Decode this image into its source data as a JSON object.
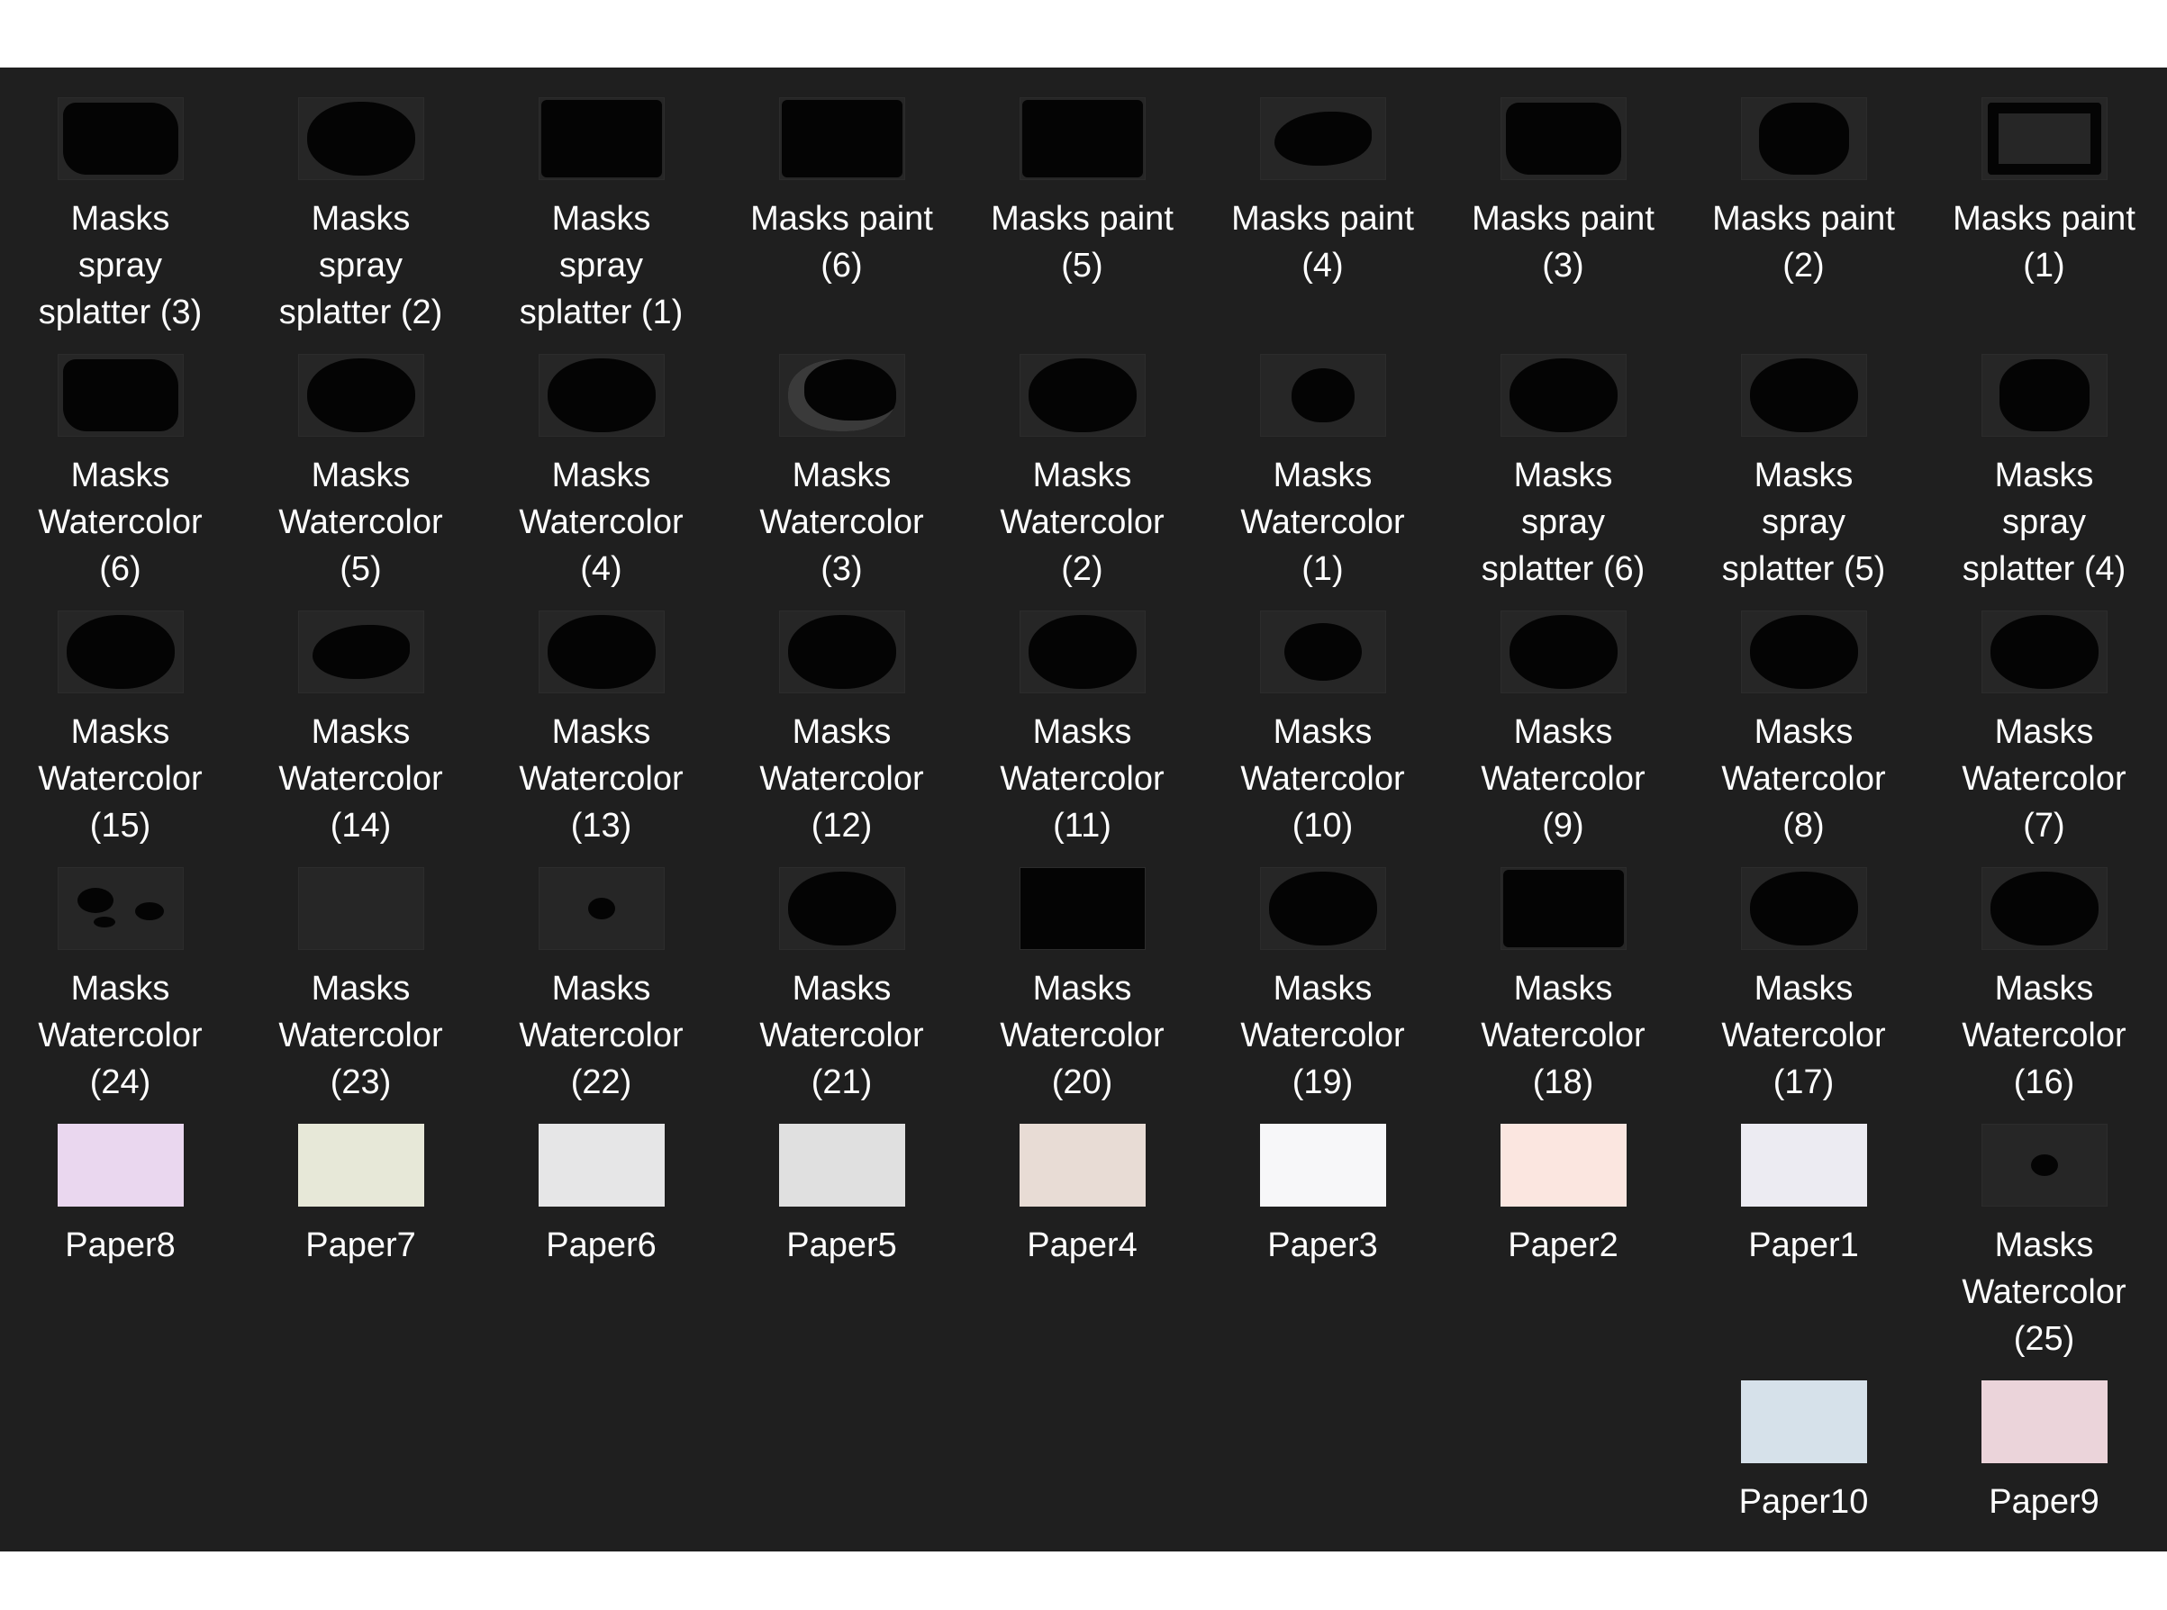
{
  "files": [
    {
      "name": "Masks spray splatter (3)",
      "label": "Masks\nspray\nsplatter (3)",
      "kind": "mask",
      "shape": "brush",
      "col": 0,
      "row": 0
    },
    {
      "name": "Masks spray splatter (2)",
      "label": "Masks\nspray\nsplatter (2)",
      "kind": "mask",
      "shape": "blob",
      "col": 1,
      "row": 0
    },
    {
      "name": "Masks spray splatter (1)",
      "label": "Masks\nspray\nsplatter (1)",
      "kind": "mask",
      "shape": "rect",
      "col": 2,
      "row": 0
    },
    {
      "name": "Masks paint (6)",
      "label": "Masks paint\n(6)",
      "kind": "mask",
      "shape": "rect",
      "col": 3,
      "row": 0
    },
    {
      "name": "Masks paint (5)",
      "label": "Masks paint\n(5)",
      "kind": "mask",
      "shape": "rect",
      "col": 4,
      "row": 0
    },
    {
      "name": "Masks paint (4)",
      "label": "Masks paint\n(4)",
      "kind": "mask",
      "shape": "stroke",
      "col": 5,
      "row": 0
    },
    {
      "name": "Masks paint (3)",
      "label": "Masks paint\n(3)",
      "kind": "mask",
      "shape": "brush",
      "col": 6,
      "row": 0
    },
    {
      "name": "Masks paint (2)",
      "label": "Masks paint\n(2)",
      "kind": "mask",
      "shape": "splat",
      "col": 7,
      "row": 0
    },
    {
      "name": "Masks paint (1)",
      "label": "Masks paint\n(1)",
      "kind": "mask",
      "shape": "frame",
      "col": 8,
      "row": 0
    },
    {
      "name": "Masks Watercolor (6)",
      "label": "Masks\nWatercolor\n(6)",
      "kind": "mask",
      "shape": "brush",
      "col": 0,
      "row": 1
    },
    {
      "name": "Masks Watercolor (5)",
      "label": "Masks\nWatercolor\n(5)",
      "kind": "mask",
      "shape": "blob",
      "col": 1,
      "row": 1
    },
    {
      "name": "Masks Watercolor (4)",
      "label": "Masks\nWatercolor\n(4)",
      "kind": "mask",
      "shape": "blob",
      "col": 2,
      "row": 1
    },
    {
      "name": "Masks Watercolor (3)",
      "label": "Masks\nWatercolor\n(3)",
      "kind": "mask",
      "shape": "ring",
      "col": 3,
      "row": 1
    },
    {
      "name": "Masks Watercolor (2)",
      "label": "Masks\nWatercolor\n(2)",
      "kind": "mask",
      "shape": "blob",
      "col": 4,
      "row": 1
    },
    {
      "name": "Masks Watercolor (1)",
      "label": "Masks\nWatercolor\n(1)",
      "kind": "mask",
      "shape": "heart",
      "col": 5,
      "row": 1
    },
    {
      "name": "Masks spray splatter (6)",
      "label": "Masks\nspray\nsplatter (6)",
      "kind": "mask",
      "shape": "blob",
      "col": 6,
      "row": 1
    },
    {
      "name": "Masks spray splatter (5)",
      "label": "Masks\nspray\nsplatter (5)",
      "kind": "mask",
      "shape": "blob",
      "col": 7,
      "row": 1
    },
    {
      "name": "Masks spray splatter (4)",
      "label": "Masks\nspray\nsplatter (4)",
      "kind": "mask",
      "shape": "splat",
      "col": 8,
      "row": 1
    },
    {
      "name": "Masks Watercolor (15)",
      "label": "Masks\nWatercolor\n(15)",
      "kind": "mask",
      "shape": "blob",
      "col": 0,
      "row": 2
    },
    {
      "name": "Masks Watercolor (14)",
      "label": "Masks\nWatercolor\n(14)",
      "kind": "mask",
      "shape": "stroke",
      "col": 1,
      "row": 2
    },
    {
      "name": "Masks Watercolor (13)",
      "label": "Masks\nWatercolor\n(13)",
      "kind": "mask",
      "shape": "blob",
      "col": 2,
      "row": 2
    },
    {
      "name": "Masks Watercolor (12)",
      "label": "Masks\nWatercolor\n(12)",
      "kind": "mask",
      "shape": "blob",
      "col": 3,
      "row": 2
    },
    {
      "name": "Masks Watercolor (11)",
      "label": "Masks\nWatercolor\n(11)",
      "kind": "mask",
      "shape": "blob",
      "col": 4,
      "row": 2
    },
    {
      "name": "Masks Watercolor (10)",
      "label": "Masks\nWatercolor\n(10)",
      "kind": "mask",
      "shape": "small",
      "col": 5,
      "row": 2
    },
    {
      "name": "Masks Watercolor (9)",
      "label": "Masks\nWatercolor\n(9)",
      "kind": "mask",
      "shape": "blob",
      "col": 6,
      "row": 2
    },
    {
      "name": "Masks Watercolor (8)",
      "label": "Masks\nWatercolor\n(8)",
      "kind": "mask",
      "shape": "blob",
      "col": 7,
      "row": 2
    },
    {
      "name": "Masks Watercolor (7)",
      "label": "Masks\nWatercolor\n(7)",
      "kind": "mask",
      "shape": "blob",
      "col": 8,
      "row": 2
    },
    {
      "name": "Masks Watercolor (24)",
      "label": "Masks\nWatercolor\n(24)",
      "kind": "mask",
      "shape": "drips",
      "col": 0,
      "row": 3
    },
    {
      "name": "Masks Watercolor (23)",
      "label": "Masks\nWatercolor\n(23)",
      "kind": "mask",
      "shape": "none",
      "col": 1,
      "row": 3
    },
    {
      "name": "Masks Watercolor (22)",
      "label": "Masks\nWatercolor\n(22)",
      "kind": "mask",
      "shape": "speck",
      "col": 2,
      "row": 3
    },
    {
      "name": "Masks Watercolor (21)",
      "label": "Masks\nWatercolor\n(21)",
      "kind": "mask",
      "shape": "blob",
      "col": 3,
      "row": 3
    },
    {
      "name": "Masks Watercolor (20)",
      "label": "Masks\nWatercolor\n(20)",
      "kind": "mask",
      "shape": "full",
      "col": 4,
      "row": 3
    },
    {
      "name": "Masks Watercolor (19)",
      "label": "Masks\nWatercolor\n(19)",
      "kind": "mask",
      "shape": "blob",
      "col": 5,
      "row": 3
    },
    {
      "name": "Masks Watercolor (18)",
      "label": "Masks\nWatercolor\n(18)",
      "kind": "mask",
      "shape": "rect",
      "col": 6,
      "row": 3
    },
    {
      "name": "Masks Watercolor (17)",
      "label": "Masks\nWatercolor\n(17)",
      "kind": "mask",
      "shape": "blob",
      "col": 7,
      "row": 3
    },
    {
      "name": "Masks Watercolor (16)",
      "label": "Masks\nWatercolor\n(16)",
      "kind": "mask",
      "shape": "blob",
      "col": 8,
      "row": 3
    },
    {
      "name": "Paper8",
      "label": "Paper8",
      "kind": "paper",
      "color": "#ead7ef",
      "col": 0,
      "row": 4
    },
    {
      "name": "Paper7",
      "label": "Paper7",
      "kind": "paper",
      "color": "#e7e8d8",
      "col": 1,
      "row": 4
    },
    {
      "name": "Paper6",
      "label": "Paper6",
      "kind": "paper",
      "color": "#e6e6e7",
      "col": 2,
      "row": 4
    },
    {
      "name": "Paper5",
      "label": "Paper5",
      "kind": "paper",
      "color": "#e0e0e0",
      "col": 3,
      "row": 4
    },
    {
      "name": "Paper4",
      "label": "Paper4",
      "kind": "paper",
      "color": "#e8dcd5",
      "col": 4,
      "row": 4
    },
    {
      "name": "Paper3",
      "label": "Paper3",
      "kind": "paper",
      "color": "#f7f7f9",
      "col": 5,
      "row": 4
    },
    {
      "name": "Paper2",
      "label": "Paper2",
      "kind": "paper",
      "color": "#fbe6e0",
      "col": 6,
      "row": 4
    },
    {
      "name": "Paper1",
      "label": "Paper1",
      "kind": "paper",
      "color": "#ecebf2",
      "col": 7,
      "row": 4
    },
    {
      "name": "Masks Watercolor (25)",
      "label": "Masks\nWatercolor\n(25)",
      "kind": "mask",
      "shape": "speck",
      "col": 8,
      "row": 4
    },
    {
      "name": "Paper10",
      "label": "Paper10",
      "kind": "paper",
      "color": "#d6e1ea",
      "col": 7,
      "row": 5
    },
    {
      "name": "Paper9",
      "label": "Paper9",
      "kind": "paper",
      "color": "#ebd4da",
      "col": 8,
      "row": 5
    }
  ]
}
